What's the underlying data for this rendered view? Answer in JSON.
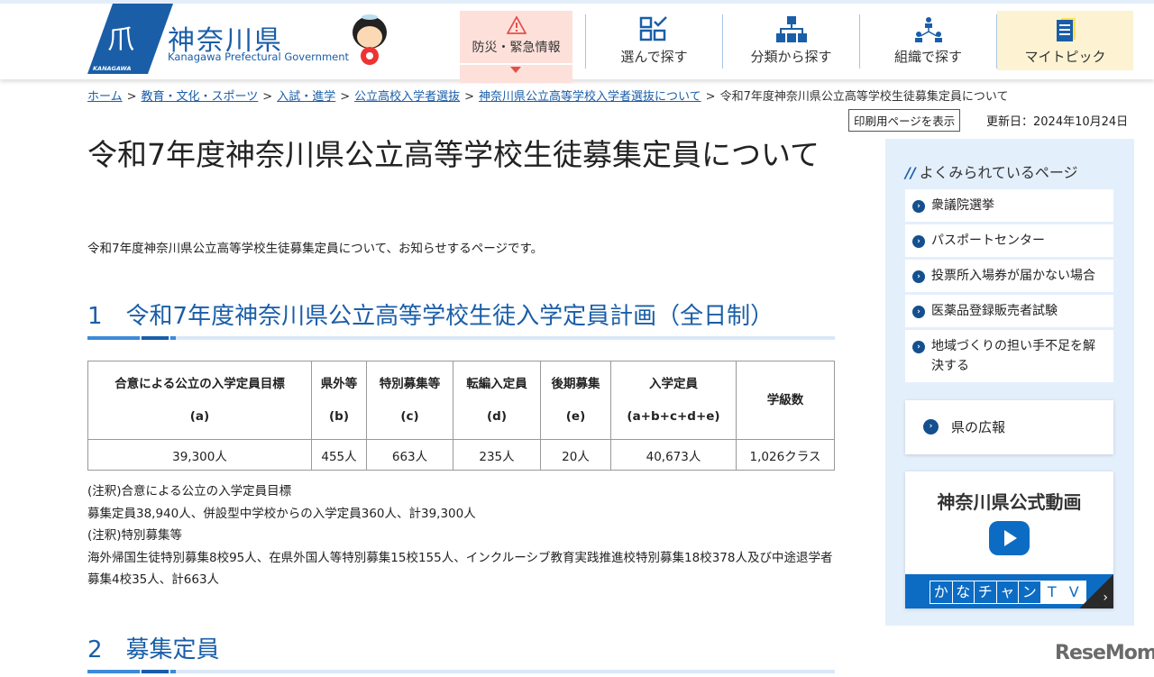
{
  "header": {
    "site_name": "神奈川県",
    "site_sub": "Kanagawa Prefectural Government",
    "logo_text": "KANAGAWA",
    "nav": {
      "emergency": "防災・緊急情報",
      "choose": "選んで探す",
      "category": "分類から探す",
      "org": "組織で探す",
      "mypick": "マイトピック"
    }
  },
  "breadcrumb": [
    "ホーム",
    "教育・文化・スポーツ",
    "入試・進学",
    "公立高校入学者選抜",
    "神奈川県公立高等学校入学者選抜について"
  ],
  "breadcrumb_current": "令和7年度神奈川県公立高等学校生徒募集定員について",
  "print_label": "印刷用ページを表示",
  "updated": "更新日：2024年10月24日",
  "title": "令和7年度神奈川県公立高等学校生徒募集定員について",
  "lead": "令和7年度神奈川県公立高等学校生徒募集定員について、お知らせするページです。",
  "section1": "1　令和7年度神奈川県公立高等学校生徒入学定員計画（全日制）",
  "section2": "2　募集定員",
  "table": {
    "headers": [
      [
        "合意による公立の入学定員目標",
        "(a)"
      ],
      [
        "県外等",
        "(b)"
      ],
      [
        "特別募集等",
        "(c)"
      ],
      [
        "転編入定員",
        "(d)"
      ],
      [
        "後期募集",
        "(e)"
      ],
      [
        "入学定員",
        "(a+b+c+d+e)"
      ],
      [
        "学級数",
        ""
      ]
    ],
    "row": [
      "39,300人",
      "455人",
      "663人",
      "235人",
      "20人",
      "40,673人",
      "1,026クラス"
    ]
  },
  "notes": [
    "(注釈)合意による公立の入学定員目標",
    "募集定員38,940人、併設型中学校からの入学定員360人、計39,300人",
    "(注釈)特別募集等",
    "海外帰国生徒特別募集8校95人、在県外国人等特別募集15校155人、インクルーシブ教育実践推進校特別募集18校378人及び中途退学者募集4校35人、計663人"
  ],
  "sidebar": {
    "title": "よくみられているページ",
    "items": [
      "衆議院選挙",
      "パスポートセンター",
      "投票所入場券が届かない場合",
      "医薬品登録販売者試験",
      "地域づくりの担い手不足を解決する"
    ],
    "koho": "県の広報",
    "video_title": "神奈川県公式動画",
    "kana_tv": [
      "か",
      "な",
      "チ",
      "ャ",
      "ン",
      "T",
      "V"
    ]
  },
  "watermark": "ReseMom"
}
